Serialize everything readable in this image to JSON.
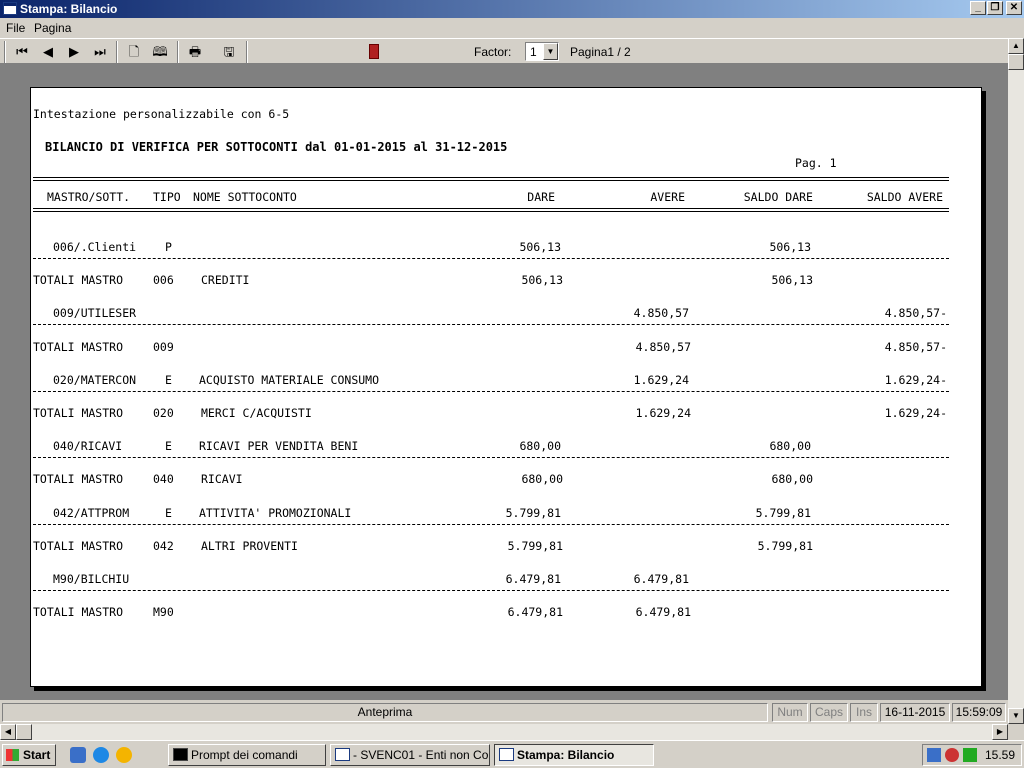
{
  "window": {
    "title": "Stampa: Bilancio",
    "min_glyph": "_",
    "max_glyph": "❐",
    "close_glyph": "✕"
  },
  "menu": {
    "file": "File",
    "pagina": "Pagina"
  },
  "toolbar": {
    "icons": [
      "first-page-icon",
      "prev-page-icon",
      "next-page-icon",
      "last-page-icon",
      "single-page-icon",
      "two-page-icon",
      "print-icon",
      "export-icon",
      "exit-icon"
    ],
    "factor_label": "Factor:",
    "factor_value": "1",
    "page_label": "Pagina1 / 2"
  },
  "report": {
    "header": "Intestazione personalizzabile con 6-5",
    "title": "BILANCIO DI VERIFICA PER SOTTOCONTI dal 01-01-2015 al 31-12-2015",
    "page_no": "Pag. 1",
    "columns": {
      "mastro": "MASTRO/SOTT.",
      "tipo": "TIPO",
      "nome": "NOME SOTTOCONTO",
      "dare": "DARE",
      "avere": "AVERE",
      "saldo_dare": "SALDO DARE",
      "saldo_avere": "SALDO AVERE"
    },
    "rows": [
      {
        "code": "006/.Clienti",
        "tipo": "P",
        "nome": "",
        "dare": "506,13",
        "avere": "",
        "saldo_dare": "506,13",
        "saldo_avere": ""
      },
      {
        "total": "TOTALI MASTRO",
        "mastro": "006",
        "nome": "CREDITI",
        "dare": "506,13",
        "avere": "",
        "saldo_dare": "506,13",
        "saldo_avere": ""
      },
      {
        "code": "009/UTILESER",
        "tipo": "",
        "nome": "",
        "dare": "",
        "avere": "4.850,57",
        "saldo_dare": "",
        "saldo_avere": "4.850,57-"
      },
      {
        "total": "TOTALI MASTRO",
        "mastro": "009",
        "nome": "",
        "dare": "",
        "avere": "4.850,57",
        "saldo_dare": "",
        "saldo_avere": "4.850,57-"
      },
      {
        "code": "020/MATERCON",
        "tipo": "E",
        "nome": "ACQUISTO MATERIALE CONSUMO",
        "dare": "",
        "avere": "1.629,24",
        "saldo_dare": "",
        "saldo_avere": "1.629,24-"
      },
      {
        "total": "TOTALI MASTRO",
        "mastro": "020",
        "nome": "MERCI C/ACQUISTI",
        "dare": "",
        "avere": "1.629,24",
        "saldo_dare": "",
        "saldo_avere": "1.629,24-"
      },
      {
        "code": "040/RICAVI",
        "tipo": "E",
        "nome": "RICAVI PER VENDITA BENI",
        "dare": "680,00",
        "avere": "",
        "saldo_dare": "680,00",
        "saldo_avere": ""
      },
      {
        "total": "TOTALI MASTRO",
        "mastro": "040",
        "nome": "RICAVI",
        "dare": "680,00",
        "avere": "",
        "saldo_dare": "680,00",
        "saldo_avere": ""
      },
      {
        "code": "042/ATTPROM",
        "tipo": "E",
        "nome": "ATTIVITA' PROMOZIONALI",
        "dare": "5.799,81",
        "avere": "",
        "saldo_dare": "5.799,81",
        "saldo_avere": ""
      },
      {
        "total": "TOTALI MASTRO",
        "mastro": "042",
        "nome": "ALTRI PROVENTI",
        "dare": "5.799,81",
        "avere": "",
        "saldo_dare": "5.799,81",
        "saldo_avere": ""
      },
      {
        "code": "M90/BILCHIU",
        "tipo": "",
        "nome": "",
        "dare": "6.479,81",
        "avere": "6.479,81",
        "saldo_dare": "",
        "saldo_avere": ""
      },
      {
        "total": "TOTALI MASTRO",
        "mastro": "M90",
        "nome": "",
        "dare": "6.479,81",
        "avere": "6.479,81",
        "saldo_dare": "",
        "saldo_avere": ""
      }
    ]
  },
  "status": {
    "mode": "Anteprima",
    "num": "Num",
    "caps": "Caps",
    "ins": "Ins",
    "date": "16-11-2015",
    "time": "15:59:09"
  },
  "taskbar": {
    "start": "Start",
    "tasks": [
      "Prompt dei comandi",
      "- SVENC01 - Enti non Co...",
      "Stampa: Bilancio"
    ],
    "clock": "15.59"
  }
}
